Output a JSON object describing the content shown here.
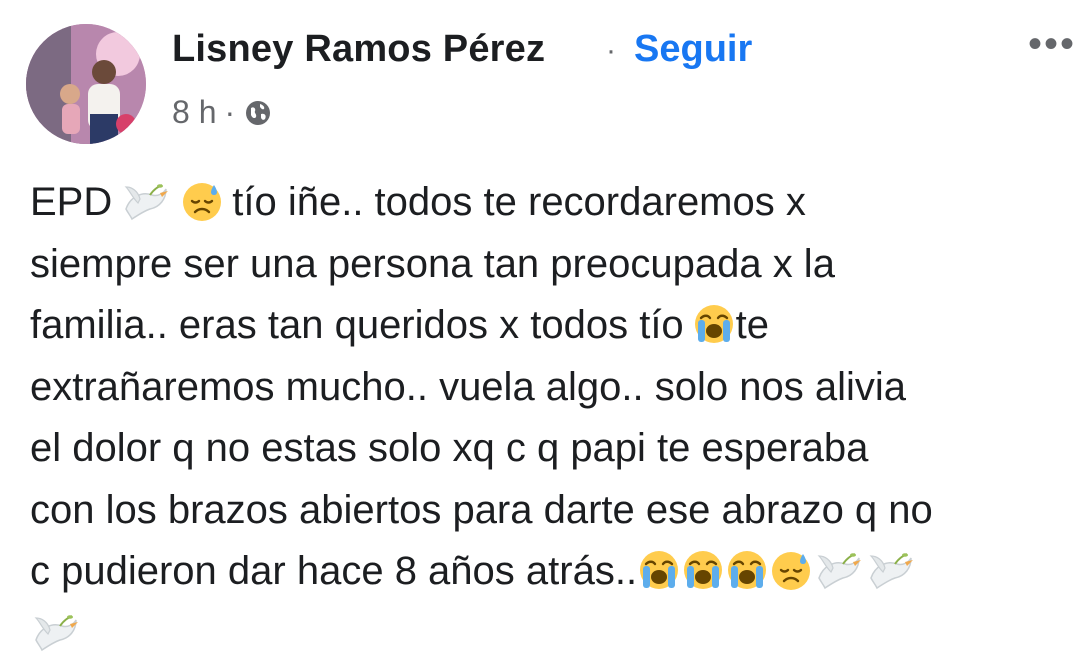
{
  "post": {
    "author": "Lisney Ramos Pérez",
    "separator": "·",
    "follow_label": "Seguir",
    "more_label": "•••",
    "time": "8 h",
    "meta_separator": "·",
    "privacy_icon": "globe-icon",
    "text": {
      "l1_a": "EPD",
      "l1_b": "tío iñe.. todos te recordaremos x",
      "l2": "siempre ser una persona tan preocupada x la",
      "l3_a": "familia.. eras tan queridos x todos tío",
      "l3_b": "te",
      "l4": "extrañaremos mucho.. vuela algo.. solo nos alivia",
      "l5": "el dolor q no estas solo xq c q papi te esperaba",
      "l6": "con los brazos abiertos para darte ese abrazo q no",
      "l7": "c pudieron dar hace 8 años atrás.."
    },
    "emoji_icons": [
      "dove-emoji",
      "sad-sweat-emoji",
      "loudly-crying-emoji"
    ]
  }
}
